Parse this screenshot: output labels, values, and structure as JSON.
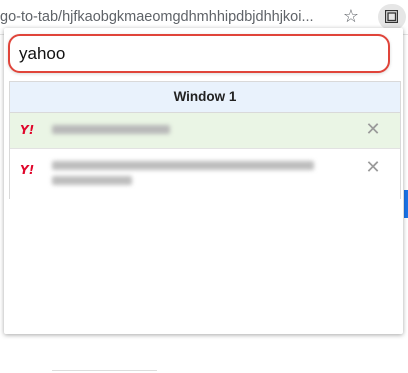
{
  "browser": {
    "url": "go-to-tab/hjfkaobgkmaeomgdhmhhipdbjdhhjkoi...",
    "bookmark_icon": "star-icon",
    "extension_icon": "tab-switcher-icon"
  },
  "popup": {
    "search": {
      "value": "yahoo"
    },
    "windows": [
      {
        "title": "Window 1",
        "tabs": [
          {
            "favicon_text": "Y!",
            "title": "",
            "active": true,
            "close_icon": "close-icon"
          },
          {
            "favicon_text": "Y!",
            "title": "",
            "active": false,
            "close_icon": "close-icon"
          }
        ]
      }
    ]
  },
  "colors": {
    "search_border": "#e0443a",
    "window_header_bg": "#e9f2fc",
    "active_tab_bg": "#eaf5e5",
    "favicon": "#e0072b"
  }
}
